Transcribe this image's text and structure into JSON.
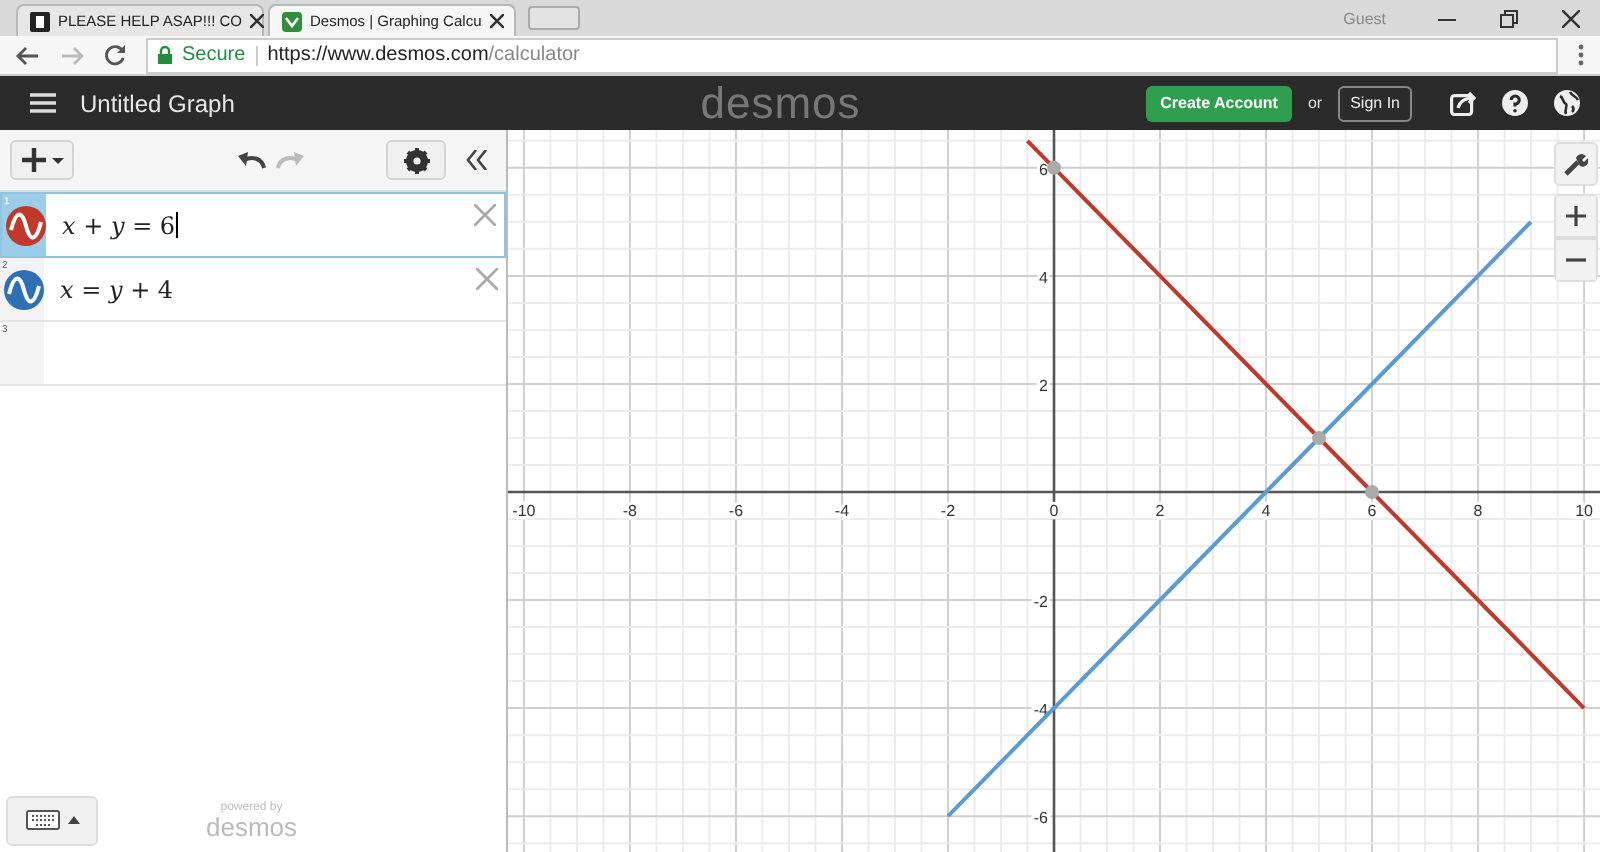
{
  "browser": {
    "tabs": [
      {
        "label": "PLEASE HELP ASAP!!! CO",
        "selected": false
      },
      {
        "label": "Desmos | Graphing Calcu",
        "selected": true
      }
    ],
    "profile": "Guest",
    "security": "Secure",
    "url_host": "https://www.desmos.com",
    "url_path": "/calculator"
  },
  "header": {
    "title": "Untitled Graph",
    "logo": "desmos",
    "create_account": "Create Account",
    "or": "or",
    "sign_in": "Sign In"
  },
  "expressions": [
    {
      "index": "1",
      "latex": "*x* + *y* = 6",
      "color": "#c0392b",
      "selected": true
    },
    {
      "index": "2",
      "latex": "*x* = *y* + 4",
      "color": "#2d70b3",
      "selected": false
    },
    {
      "index": "3",
      "selected": false
    }
  ],
  "footer": {
    "powered_by": "powered by",
    "brand": "desmos"
  },
  "graph": {
    "chart_data": {
      "type": "line",
      "grid": true,
      "x": [
        -2,
        -0.5,
        0,
        2,
        4,
        5,
        6,
        8,
        9,
        10
      ],
      "series": [
        {
          "color": "#c0392b",
          "values": [
            null,
            6.5,
            6,
            4,
            2,
            1,
            0,
            -2,
            -3,
            -4
          ]
        },
        {
          "color": "#5b9bd5",
          "values": [
            -6,
            -4.5,
            -4,
            -2,
            0,
            1,
            2,
            4,
            5,
            null
          ]
        }
      ],
      "xlim": [
        -10.3,
        10.3
      ],
      "ylim": [
        -6.7,
        6.7
      ],
      "xticks": [
        -10,
        -8,
        -6,
        -4,
        -2,
        0,
        2,
        4,
        6,
        8,
        10
      ],
      "yticks": [
        -6,
        -4,
        -2,
        2,
        4,
        6
      ]
    }
  }
}
